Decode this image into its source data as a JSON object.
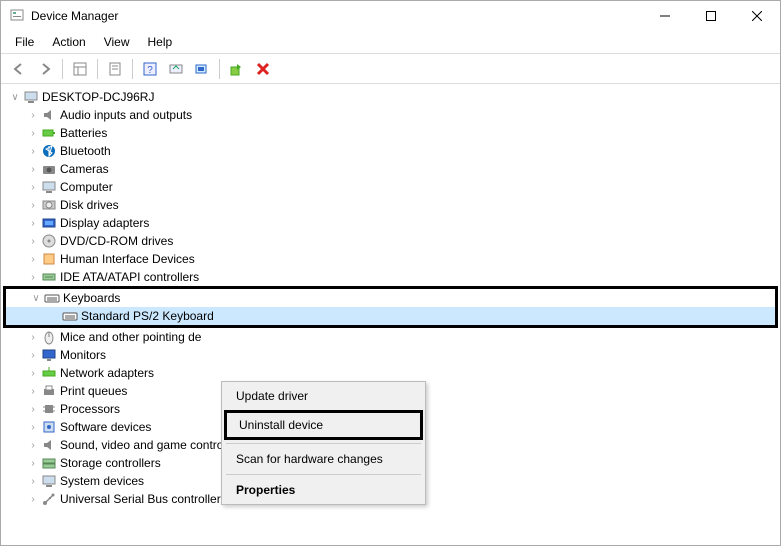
{
  "window": {
    "title": "Device Manager"
  },
  "menubar": {
    "file": "File",
    "action": "Action",
    "view": "View",
    "help": "Help"
  },
  "tree": {
    "root": "DESKTOP-DCJ96RJ",
    "categories": [
      "Audio inputs and outputs",
      "Batteries",
      "Bluetooth",
      "Cameras",
      "Computer",
      "Disk drives",
      "Display adapters",
      "DVD/CD-ROM drives",
      "Human Interface Devices",
      "IDE ATA/ATAPI controllers"
    ],
    "keyboards": {
      "label": "Keyboards",
      "child": "Standard PS/2 Keyboard"
    },
    "categories2": [
      "Mice and other pointing de",
      "Monitors",
      "Network adapters",
      "Print queues",
      "Processors",
      "Software devices",
      "Sound, video and game controllers",
      "Storage controllers",
      "System devices",
      "Universal Serial Bus controllers"
    ]
  },
  "ctx": {
    "update": "Update driver",
    "uninstall": "Uninstall device",
    "scan": "Scan for hardware changes",
    "properties": "Properties"
  }
}
